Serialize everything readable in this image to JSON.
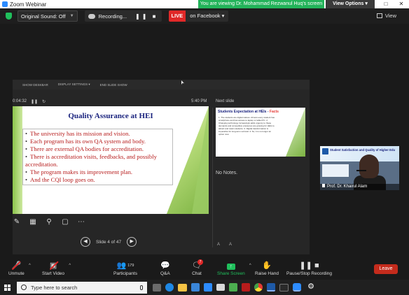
{
  "window": {
    "title": "Zoom Webinar"
  },
  "banner": {
    "viewing": "You are viewing Dr. Mohammad Rezwanul Huq's screen",
    "view_options": "View Options"
  },
  "topbar": {
    "sound": "Original Sound: Off",
    "recording": "Recording...",
    "live_badge": "LIVE",
    "live_target": "on Facebook",
    "view": "View"
  },
  "presenter": {
    "toolbar": [
      "SHOW DESKBAR",
      "DISPLAY SETTINGS ▾",
      "END SLIDE SHOW"
    ],
    "timer": "0:04:32",
    "clock": "5:40 PM",
    "next_label": "Next slide",
    "notes": "No Notes.",
    "slide_counter": "Slide 4 of 47"
  },
  "slide": {
    "title": "Quality Assurance at HEI",
    "bullets": [
      "The university has its mission and vision.",
      "Each program has its own QA system and body.",
      "There are external QA bodies for accreditation.",
      "There is accreditation visits, feedbacks, and possibly accreditation.",
      "The program makes its improvement plan.",
      "And the CQI loop goes on."
    ]
  },
  "next_slide": {
    "title_a": "Students Expectation at HEIs - ",
    "title_b": "Facts",
    "body": "1. The students are digital natives. Almost every student has smartphone and has access to laptop or tablet PC. 2. Changing technology increasingly adds urgency to these demands and competitive pressures are growing for HEIs to attract and retain students. 3. Digital transformation is imperative for long-term survival. 4. So, it is no longer an option now."
  },
  "video": {
    "name": "Prof. Dr. Khairul Alam",
    "banner": "Student Satisfaction and Quality of Higher Edu"
  },
  "toolbar": {
    "unmute": "Unmute",
    "start_video": "Start Video",
    "participants": "Participants",
    "participants_count": "179",
    "qa": "Q&A",
    "chat": "Chat",
    "chat_badge": "7",
    "share": "Share Screen",
    "raise": "Raise Hand",
    "pause": "Pause/Stop Recording",
    "leave": "Leave"
  },
  "taskbar": {
    "search_placeholder": "Type here to search"
  }
}
